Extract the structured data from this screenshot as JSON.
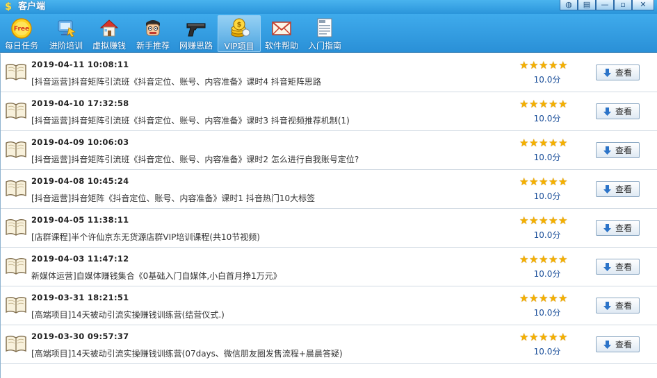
{
  "window": {
    "title": "客户端",
    "app_icon": "$"
  },
  "window_controls": [
    {
      "icon": "skin-icon",
      "glyph": "◍"
    },
    {
      "icon": "menu-icon",
      "glyph": "▤"
    },
    {
      "icon": "minimize-icon",
      "glyph": "—"
    },
    {
      "icon": "maximize-icon",
      "glyph": "▫"
    },
    {
      "icon": "close-icon",
      "glyph": "✕"
    }
  ],
  "toolbar": {
    "items": [
      {
        "label": "每日任务",
        "icon": "free-badge-icon"
      },
      {
        "label": "进阶培训",
        "icon": "training-monitor-icon"
      },
      {
        "label": "虚拟赚钱",
        "icon": "house-icon"
      },
      {
        "label": "新手推荐",
        "icon": "cartoon-face-icon"
      },
      {
        "label": "网赚思路",
        "icon": "pistol-icon"
      },
      {
        "label": "VIP项目",
        "icon": "gold-coins-icon",
        "active": true
      },
      {
        "label": "软件帮助",
        "icon": "envelope-icon"
      },
      {
        "label": "入门指南",
        "icon": "document-icon"
      }
    ],
    "free_text": "Free"
  },
  "list": {
    "view_label": "查看",
    "items": [
      {
        "date": "2019-04-11 10:08:11",
        "title": "[抖音运营]抖音矩阵引流班《抖音定位、账号、内容准备》课时4 抖音矩阵思路",
        "score": "10.0分",
        "rating": 5
      },
      {
        "date": "2019-04-10 17:32:58",
        "title": "[抖音运营]抖音矩阵引流班《抖音定位、账号、内容准备》课时3 抖音视频推荐机制(1)",
        "score": "10.0分",
        "rating": 5
      },
      {
        "date": "2019-04-09 10:06:03",
        "title": "[抖音运营]抖音矩阵引流班《抖音定位、账号、内容准备》课时2 怎么进行自我账号定位?",
        "score": "10.0分",
        "rating": 5
      },
      {
        "date": "2019-04-08 10:45:24",
        "title": "[抖音运营]抖音矩阵《抖音定位、账号、内容准备》课时1 抖音热门10大标签",
        "score": "10.0分",
        "rating": 5
      },
      {
        "date": "2019-04-05 11:38:11",
        "title": "[店群课程]半个许仙京东无货源店群VIP培训课程(共10节视频)",
        "score": "10.0分",
        "rating": 5
      },
      {
        "date": "2019-04-03 11:47:12",
        "title": "新媒体运营]自媒体赚钱集合《0基础入门自媒体,小白首月挣1万元》",
        "score": "10.0分",
        "rating": 5
      },
      {
        "date": "2019-03-31 18:21:51",
        "title": "[高端项目]14天被动引流实操赚钱训练营(结营仪式.)",
        "score": "10.0分",
        "rating": 5
      },
      {
        "date": "2019-03-30 09:57:37",
        "title": "[高端项目]14天被动引流实操赚钱训练营(07days、微信朋友圈发售流程+晨晨答疑)",
        "score": "10.0分",
        "rating": 5
      }
    ]
  },
  "colors": {
    "titlebar": "#2a95db",
    "star": "#f4b000",
    "score": "#1b4f9a"
  }
}
